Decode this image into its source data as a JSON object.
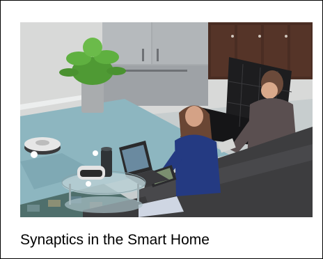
{
  "caption": "Synaptics in the Smart Home",
  "scene_palette": {
    "wall": "#d8d9d8",
    "floor": "#c9cfcf",
    "rug": "#8fb7c1",
    "fridge": "#a9adb0",
    "cabinets": "#4a2d23",
    "sofa": "#3d3d3f",
    "chair": "#1c1c1e",
    "woman_top": "#243a82",
    "man_top": "#5a4f50",
    "plant": "#5aa63a"
  }
}
